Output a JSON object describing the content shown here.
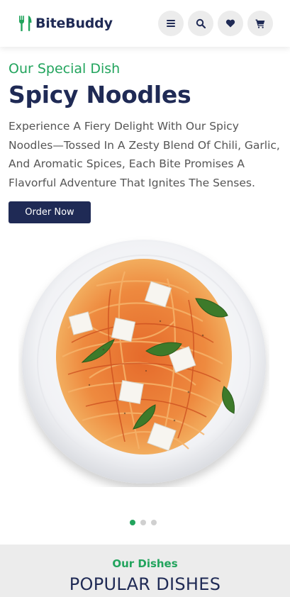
{
  "brand": {
    "name": "BiteBuddy",
    "icon": "fork-knife-icon",
    "accent": "#22a45d",
    "navy": "#1f2a55"
  },
  "header": {
    "actions": [
      {
        "icon": "menu-icon"
      },
      {
        "icon": "search-icon"
      },
      {
        "icon": "heart-icon"
      },
      {
        "icon": "cart-icon"
      }
    ]
  },
  "hero": {
    "eyebrow": "Our Special Dish",
    "title": "Spicy Noodles",
    "description": "Experience A Fiery Delight With Our Spicy Noodles—Tossed In A Zesty Blend Of Chili, Garlic, And Aromatic Spices, Each Bite Promises A Flavorful Adventure That Ignites The Senses.",
    "cta_label": "Order Now",
    "image": "spaghetti-plate-image"
  },
  "carousel": {
    "count": 3,
    "active": 1
  },
  "dishes_section": {
    "eyebrow": "Our Dishes",
    "title": "POPULAR DISHES"
  }
}
